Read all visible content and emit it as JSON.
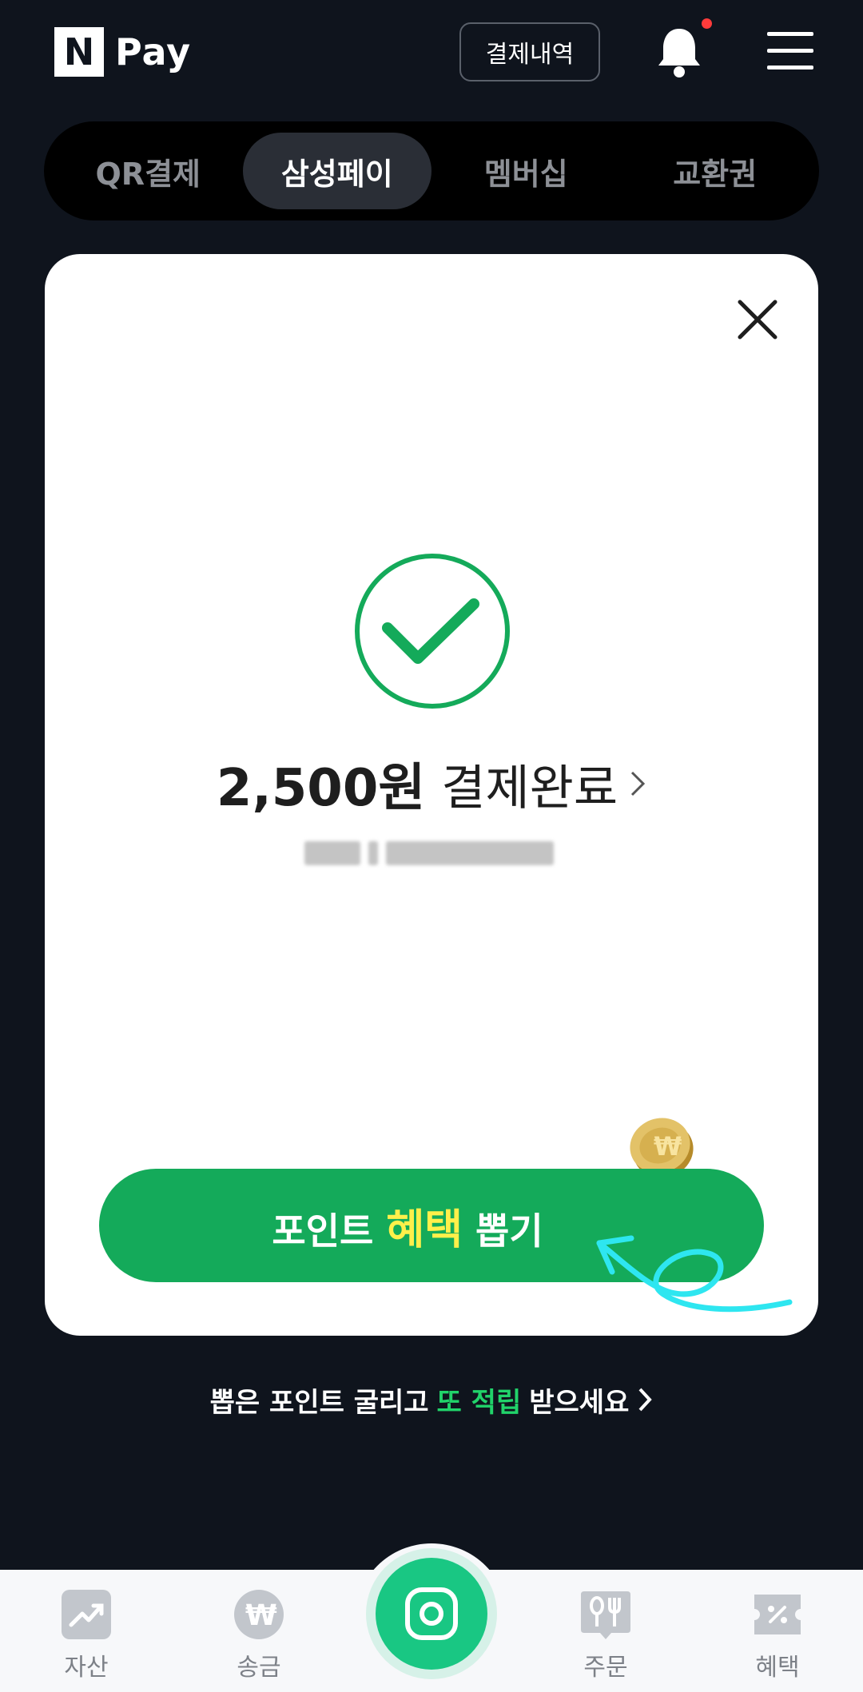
{
  "header": {
    "logo_letter": "N",
    "logo_text": "Pay",
    "history_label": "결제내역",
    "bell_icon": "bell-icon",
    "menu_icon": "hamburger-menu-icon"
  },
  "tabs": [
    {
      "label": "QR결제",
      "active": false
    },
    {
      "label": "삼성페이",
      "active": true
    },
    {
      "label": "멤버십",
      "active": false
    },
    {
      "label": "교환권",
      "active": false
    }
  ],
  "card": {
    "close_icon": "close-icon",
    "status_icon": "check-circle-icon",
    "amount": "2,500원",
    "status": "결제완료",
    "button": {
      "prefix": "포인트",
      "highlight": "혜택",
      "suffix": "뽑기"
    }
  },
  "promo": {
    "prefix": "뽑은 포인트 굴리고",
    "highlight": "또 적립",
    "suffix": "받으세요"
  },
  "bottom_nav": {
    "items": [
      {
        "label": "자산",
        "icon": "chart-up-icon"
      },
      {
        "label": "송금",
        "icon": "won-icon"
      },
      {
        "label": "주문",
        "icon": "utensils-icon"
      },
      {
        "label": "혜택",
        "icon": "coupon-icon"
      }
    ],
    "center_icon": "camera-icon"
  },
  "colors": {
    "background": "#0f141d",
    "accent_green": "#14aa5a",
    "highlight_yellow": "#fff04a",
    "promo_green": "#21d36a",
    "notification_dot": "#ff3b3b"
  }
}
